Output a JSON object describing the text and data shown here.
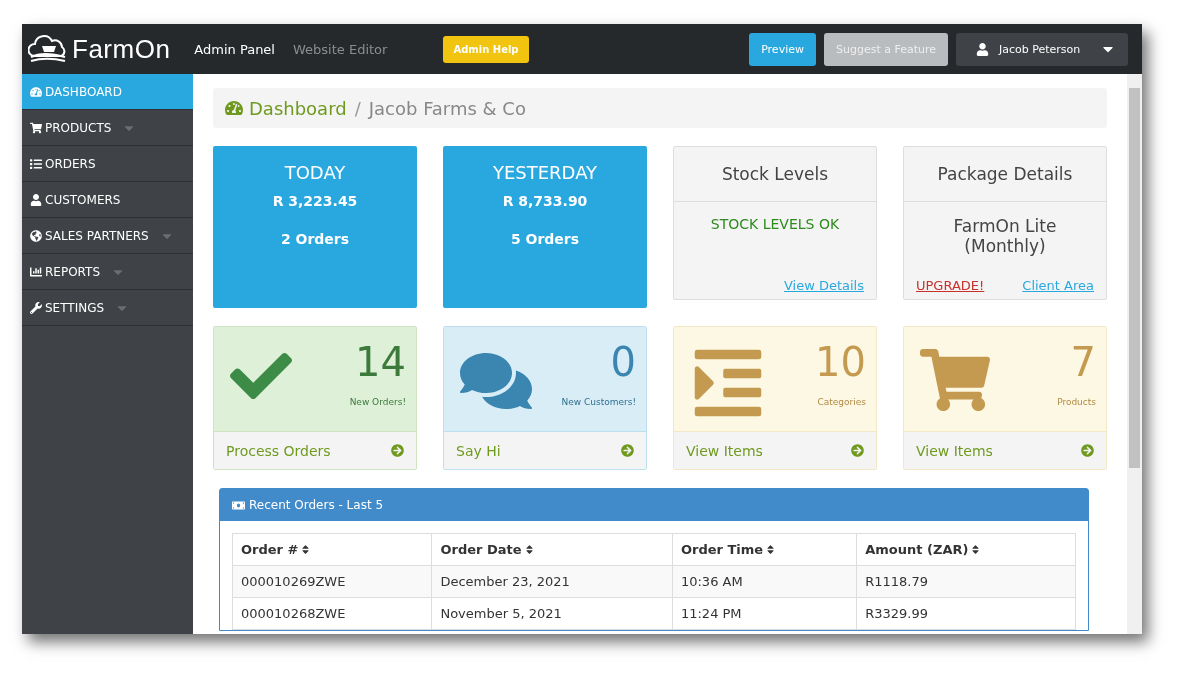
{
  "header": {
    "logo": "FarmOn",
    "nav": [
      {
        "label": "Admin Panel",
        "selected": true
      },
      {
        "label": "Website Editor",
        "selected": false
      }
    ],
    "help_button": "Admin Help",
    "buttons": [
      {
        "label": "Preview",
        "kind": "primary"
      },
      {
        "label": "Suggest a Feature",
        "kind": "muted"
      }
    ],
    "user": "Jacob Peterson"
  },
  "sidebar": {
    "items": [
      {
        "label": "DASHBOARD",
        "selected": true,
        "has_submenu": false
      },
      {
        "label": "PRODUCTS",
        "selected": false,
        "has_submenu": true
      },
      {
        "label": "ORDERS",
        "selected": false,
        "has_submenu": false
      },
      {
        "label": "CUSTOMERS",
        "selected": false,
        "has_submenu": false
      },
      {
        "label": "SALES PARTNERS",
        "selected": false,
        "has_submenu": true
      },
      {
        "label": "REPORTS",
        "selected": false,
        "has_submenu": true
      },
      {
        "label": "SETTINGS",
        "selected": false,
        "has_submenu": true
      }
    ]
  },
  "breadcrumb_separator": "/",
  "breadcrumb": [
    {
      "label": "Dashboard",
      "selected": true
    },
    {
      "label": "Jacob Farms & Co",
      "selected": false
    }
  ],
  "summary_cards": [
    {
      "kind": "sales",
      "title": "TODAY",
      "amount": "R 3,223.45",
      "orders": "2 Orders"
    },
    {
      "kind": "sales",
      "title": "YESTERDAY",
      "amount": "R 8,733.90",
      "orders": "5 Orders"
    },
    {
      "kind": "info",
      "title": "Stock Levels",
      "status": "STOCK LEVELS OK",
      "links": [
        {
          "label": "View Details",
          "kind": "normal"
        }
      ]
    },
    {
      "kind": "info",
      "title": "Package Details",
      "plan": "FarmOn Lite (Monthly)",
      "links": [
        {
          "label": "UPGRADE!",
          "kind": "danger"
        },
        {
          "label": "Client Area",
          "kind": "normal"
        }
      ]
    }
  ],
  "tiles": [
    {
      "kind": "success",
      "count": "14",
      "caption": "New Orders!",
      "link": "Process Orders"
    },
    {
      "kind": "info",
      "count": "0",
      "caption": "New Customers!",
      "link": "Say Hi"
    },
    {
      "kind": "warning",
      "count": "10",
      "caption": "Categories",
      "link": "View Items"
    },
    {
      "kind": "warning",
      "count": "7",
      "caption": "Products",
      "link": "View Items"
    }
  ],
  "recent_orders": {
    "title": "Recent Orders - Last 5",
    "columns": [
      "Order #",
      "Order Date",
      "Order Time",
      "Amount (ZAR)"
    ],
    "rows": [
      [
        "000010269ZWE",
        "December 23, 2021",
        "10:36 AM",
        "R1118.79"
      ],
      [
        "000010268ZWE",
        "November 5, 2021",
        "11:24 PM",
        "R3329.99"
      ]
    ]
  }
}
